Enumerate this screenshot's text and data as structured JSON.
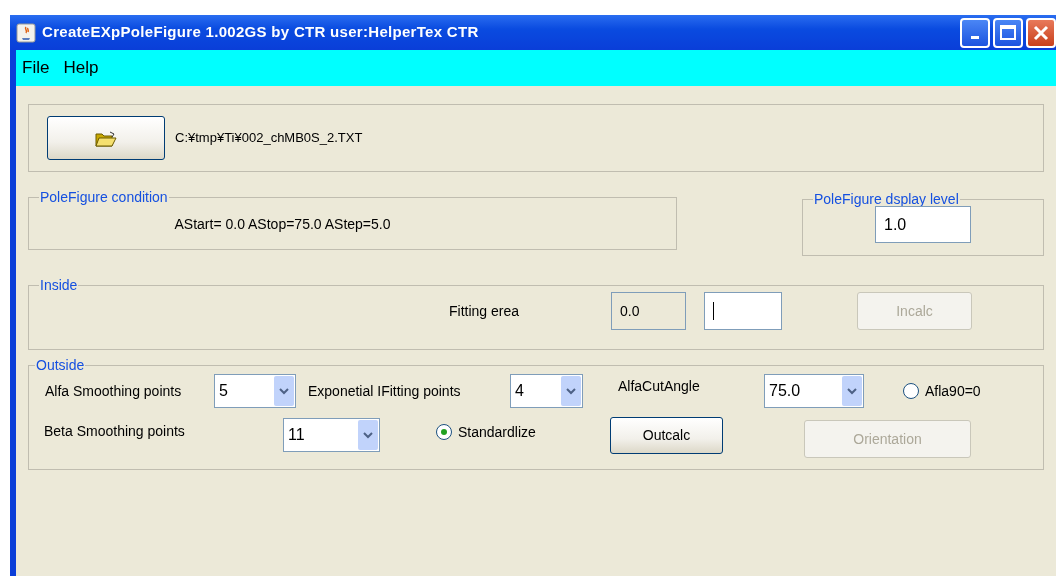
{
  "window": {
    "title": "CreateEXpPoleFigure 1.002GS by CTR  user:HelperTex CTR"
  },
  "menu": [
    {
      "label": "File"
    },
    {
      "label": "Help"
    }
  ],
  "file_panel": {
    "path": "C:¥tmp¥Ti¥002_chMB0S_2.TXT"
  },
  "condition": {
    "title": "PoleFigure condition",
    "text": "AStart= 0.0 AStop=75.0 AStep=5.0"
  },
  "display_level": {
    "title": "PoleFigure dsplay level",
    "value": "1.0"
  },
  "inside": {
    "title": "Inside",
    "label": "Fitting erea",
    "readout": "0.0",
    "button": {
      "label": "Incalc",
      "disabled": true
    }
  },
  "outside": {
    "title": "Outside",
    "alfa_smoothing": {
      "label": "Alfa Smoothing points",
      "value": "5"
    },
    "exp_fitting": {
      "label": "Exponetial IFitting points",
      "value": "4"
    },
    "alfa_cut": {
      "label": "AlfaCutAngle",
      "value": "75.0"
    },
    "afla90": {
      "label": "Afla90=0",
      "selected": false
    },
    "beta_smoothing": {
      "label": "Beta Smoothing points",
      "value": "11"
    },
    "standardlize": {
      "label": "Standardlize",
      "selected": true
    },
    "outcalc": {
      "label": "Outcalc",
      "disabled": false
    },
    "orientation": {
      "label": "Orientation",
      "disabled": true
    }
  }
}
